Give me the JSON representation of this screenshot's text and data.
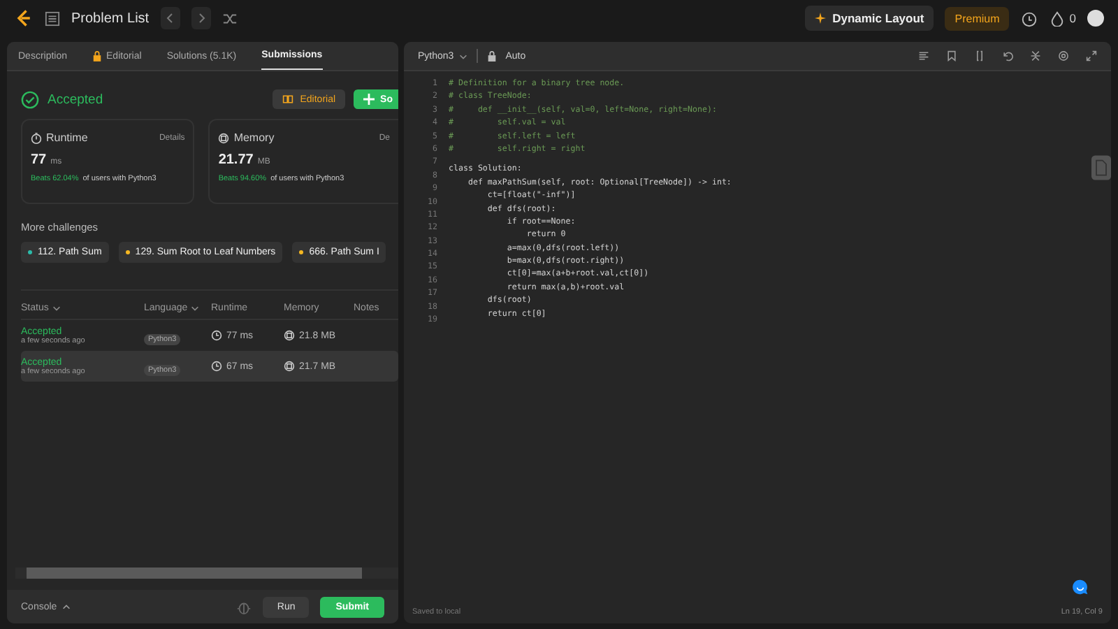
{
  "topbar": {
    "title": "Problem List",
    "dynamic_layout": "Dynamic Layout",
    "premium": "Premium",
    "streak": "0"
  },
  "tabs": [
    {
      "label": "Description",
      "selected": false,
      "locked": false
    },
    {
      "label": "Editorial",
      "selected": false,
      "locked": true
    },
    {
      "label": "Solutions (5.1K)",
      "selected": false,
      "locked": false
    },
    {
      "label": "Submissions",
      "selected": true,
      "locked": false
    }
  ],
  "result": {
    "status": "Accepted",
    "editorial_button": "Editorial",
    "solution_button": "So"
  },
  "cards": [
    {
      "kind": "runtime",
      "label": "Runtime",
      "details": "Details",
      "value": "77",
      "unit": "ms",
      "beats": "Beats 62.04%",
      "beats_rest": "of users with Python3"
    },
    {
      "kind": "memory",
      "label": "Memory",
      "details": "De",
      "value": "21.77",
      "unit": "MB",
      "beats": "Beats 94.60%",
      "beats_rest": "of users with Python3"
    }
  ],
  "more_challenges": {
    "title": "More challenges",
    "items": [
      {
        "label": "112. Path Sum",
        "color": "#2cbbaa"
      },
      {
        "label": "129. Sum Root to Leaf Numbers",
        "color": "#f5b721"
      },
      {
        "label": "666. Path Sum I",
        "color": "#f5b721"
      }
    ]
  },
  "table": {
    "columns": [
      "Status",
      "Language",
      "Runtime",
      "Memory",
      "Notes"
    ],
    "rows": [
      {
        "status": "Accepted",
        "time": "a few seconds ago",
        "language": "Python3",
        "runtime": "77 ms",
        "memory": "21.8 MB",
        "selected": false
      },
      {
        "status": "Accepted",
        "time": "a few seconds ago",
        "language": "Python3",
        "runtime": "67 ms",
        "memory": "21.7 MB",
        "selected": true
      }
    ]
  },
  "console": {
    "label": "Console",
    "run": "Run",
    "submit": "Submit"
  },
  "editor": {
    "language": "Python3",
    "mode": "Auto",
    "saved": "Saved to local",
    "cursor": "Ln 19, Col 9",
    "lines": [
      {
        "n": "1",
        "kind": "comment",
        "text": "# Definition for a binary tree node."
      },
      {
        "n": "2",
        "kind": "comment",
        "text": "# class TreeNode:"
      },
      {
        "n": "3",
        "kind": "comment",
        "text": "#     def __init__(self, val=0, left=None, right=None):"
      },
      {
        "n": "4",
        "kind": "comment",
        "text": "#         self.val = val"
      },
      {
        "n": "5",
        "kind": "comment",
        "text": "#         self.left = left"
      },
      {
        "n": "6",
        "kind": "comment",
        "text": "#         self.right = right"
      },
      {
        "n": "7",
        "kind": "code",
        "text": "class Solution:"
      },
      {
        "n": "8",
        "kind": "code",
        "text": "    def maxPathSum(self, root: Optional[TreeNode]) -> int:"
      },
      {
        "n": "9",
        "kind": "code",
        "text": "        ct=[float(\"-inf\")]"
      },
      {
        "n": "10",
        "kind": "code",
        "text": "        def dfs(root):"
      },
      {
        "n": "11",
        "kind": "code",
        "text": "            if root==None:"
      },
      {
        "n": "12",
        "kind": "code",
        "text": "                return 0"
      },
      {
        "n": "13",
        "kind": "code",
        "text": "            a=max(0,dfs(root.left))"
      },
      {
        "n": "14",
        "kind": "code",
        "text": "            b=max(0,dfs(root.right))"
      },
      {
        "n": "15",
        "kind": "code",
        "text": "            ct[0]=max(a+b+root.val,ct[0])"
      },
      {
        "n": "16",
        "kind": "code",
        "text": "            return max(a,b)+root.val"
      },
      {
        "n": "17",
        "kind": "code",
        "text": "        dfs(root)"
      },
      {
        "n": "18",
        "kind": "code",
        "text": "        return ct[0]"
      },
      {
        "n": "19"
      }
    ]
  }
}
